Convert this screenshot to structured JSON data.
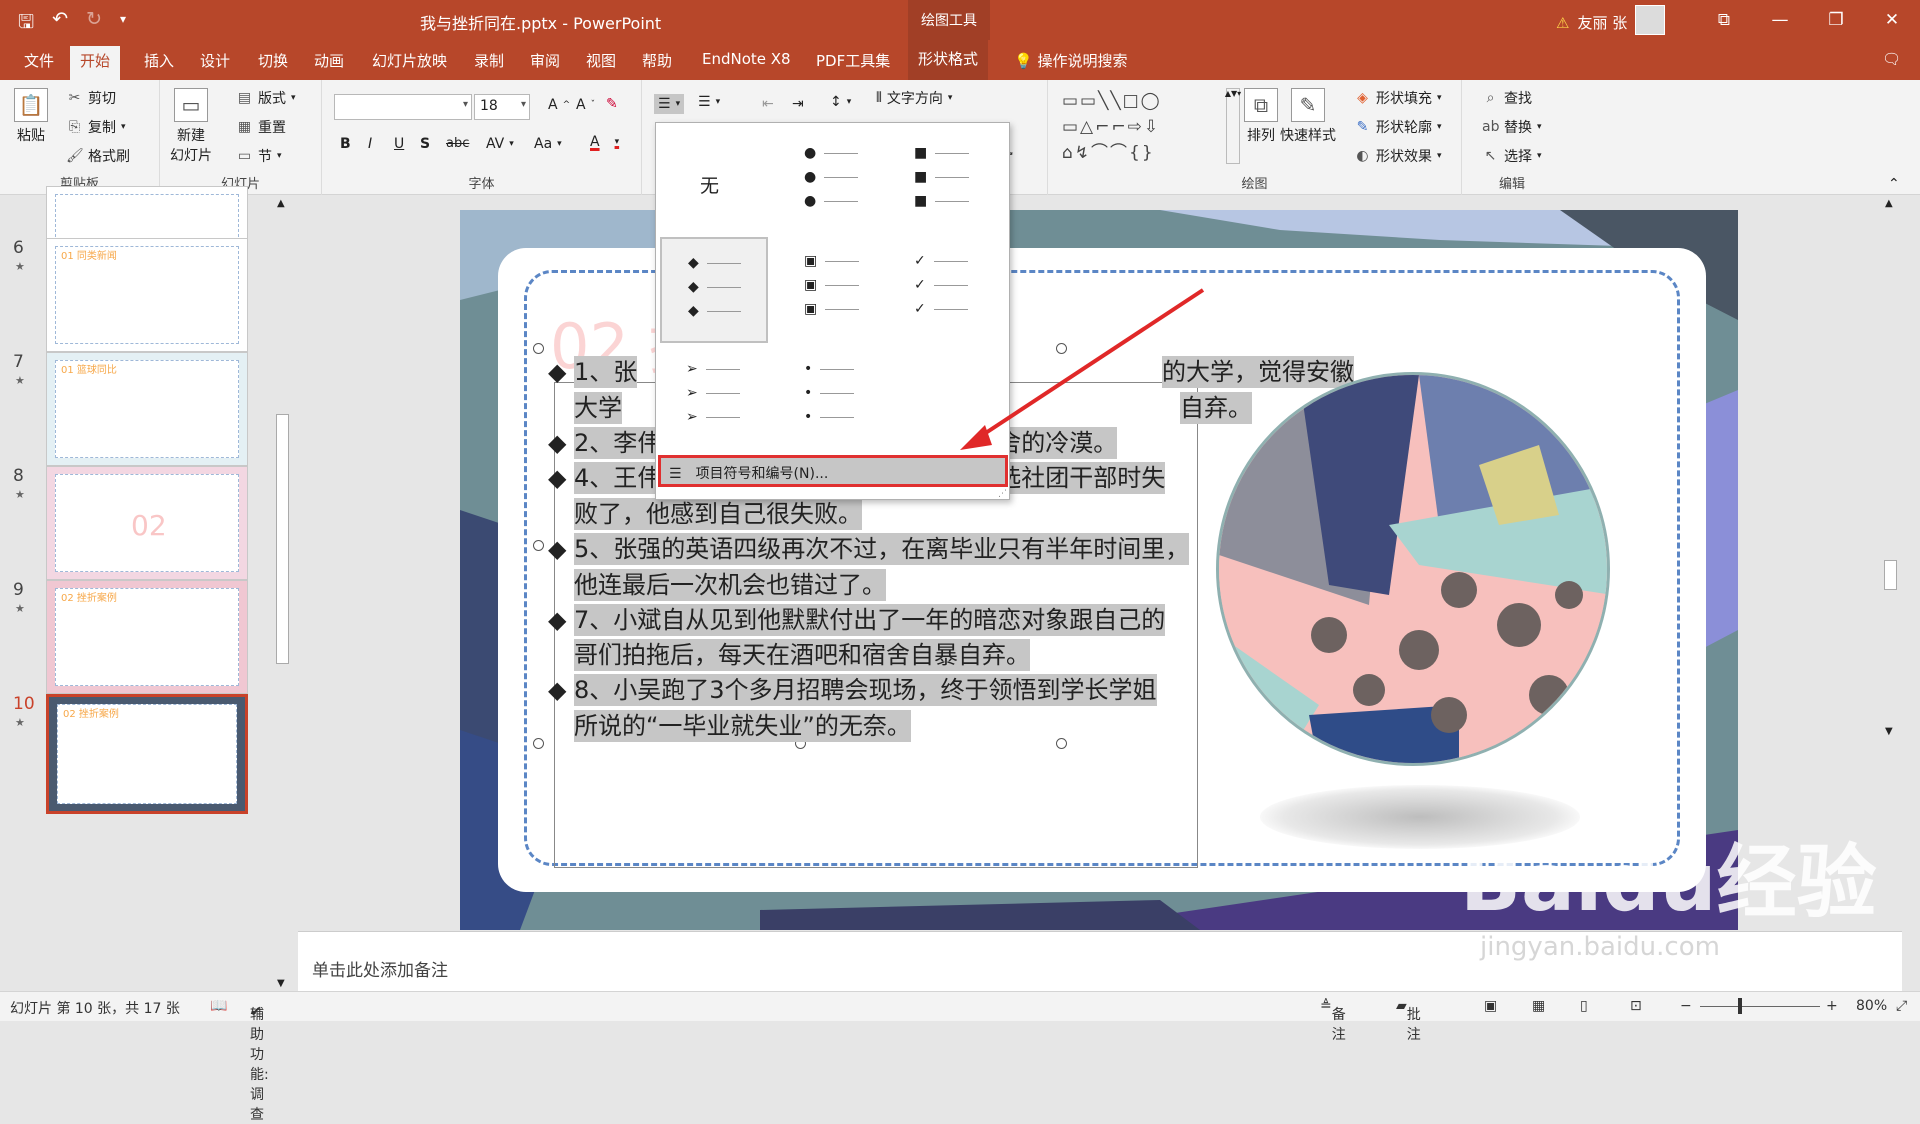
{
  "window": {
    "title": "我与挫折同在.pptx  -  PowerPoint",
    "context_group": "绘图工具",
    "user": "友丽 张"
  },
  "tabs": [
    "文件",
    "开始",
    "插入",
    "设计",
    "切换",
    "动画",
    "幻灯片放映",
    "录制",
    "审阅",
    "视图",
    "帮助",
    "EndNote X8",
    "PDF工具集",
    "形状格式",
    "操作说明搜索"
  ],
  "ribbon": {
    "clipboard": {
      "label": "剪贴板",
      "paste": "粘贴",
      "cut": "剪切",
      "copy": "复制",
      "format_painter": "格式刷"
    },
    "slides": {
      "label": "幻灯片",
      "new_slide": "新建\n幻灯片",
      "layout": "版式",
      "reset": "重置",
      "section": "节"
    },
    "font": {
      "label": "字体",
      "font_name": "",
      "font_size": "18",
      "bold": "B",
      "italic": "I",
      "underline": "U",
      "shadow": "S",
      "strike": "abc",
      "spacing": "AV",
      "case": "Aa"
    },
    "paragraph": {
      "text_direction": "文字方向"
    },
    "drawing": {
      "label": "绘图",
      "arrange": "排列",
      "quick_styles": "快速样式",
      "shape_fill": "形状填充",
      "shape_outline": "形状轮廓",
      "shape_effects": "形状效果"
    },
    "editing": {
      "label": "编辑",
      "find": "查找",
      "replace": "替换",
      "select": "选择"
    }
  },
  "thumbnails": [
    {
      "num": "6",
      "label": "01 同类新闻"
    },
    {
      "num": "7",
      "label": "01 篮球同比"
    },
    {
      "num": "8",
      "label": "",
      "big": "02"
    },
    {
      "num": "9",
      "label": "02 挫折案例"
    },
    {
      "num": "10",
      "label": "02 挫折案例",
      "selected": true
    }
  ],
  "slide": {
    "title": "02 挫",
    "bullets": [
      "1、张",
      "大学",
      "2、李伟很害怕回宿舍，因为无法忍受宿舍的冷漠。",
      "4、王伟准备了半个多月，最终还是在竞选社团干部时失",
      "败了，他感到自己很失败。",
      "5、张强的英语四级再次不过，在离毕业只有半年时间里，",
      "他连最后一次机会也错过了。",
      "7、小斌自从见到他默默付出了一年的暗恋对象跟自己的",
      "哥们拍拖后，每天在酒吧和宿舍自暴自弃。",
      "8、小吴跑了3个多月招聘会现场，终于领悟到学长学姐",
      "所说的“一毕业就失业”的无奈。"
    ],
    "line1_tail": "的大学，觉得安徽",
    "line2_tail": "自弃。"
  },
  "bullet_menu": {
    "none": "无",
    "footer": "项目符号和编号(N)..."
  },
  "notes_placeholder": "单击此处添加备注",
  "status": {
    "slide_info": "幻灯片 第 10 张，共 17 张",
    "accessibility": "辅助功能: 调查",
    "notes": "备注",
    "comments": "批注",
    "zoom": "80%"
  },
  "watermark": {
    "brand": "Baidu经验",
    "url": "jingyan.baidu.com"
  }
}
